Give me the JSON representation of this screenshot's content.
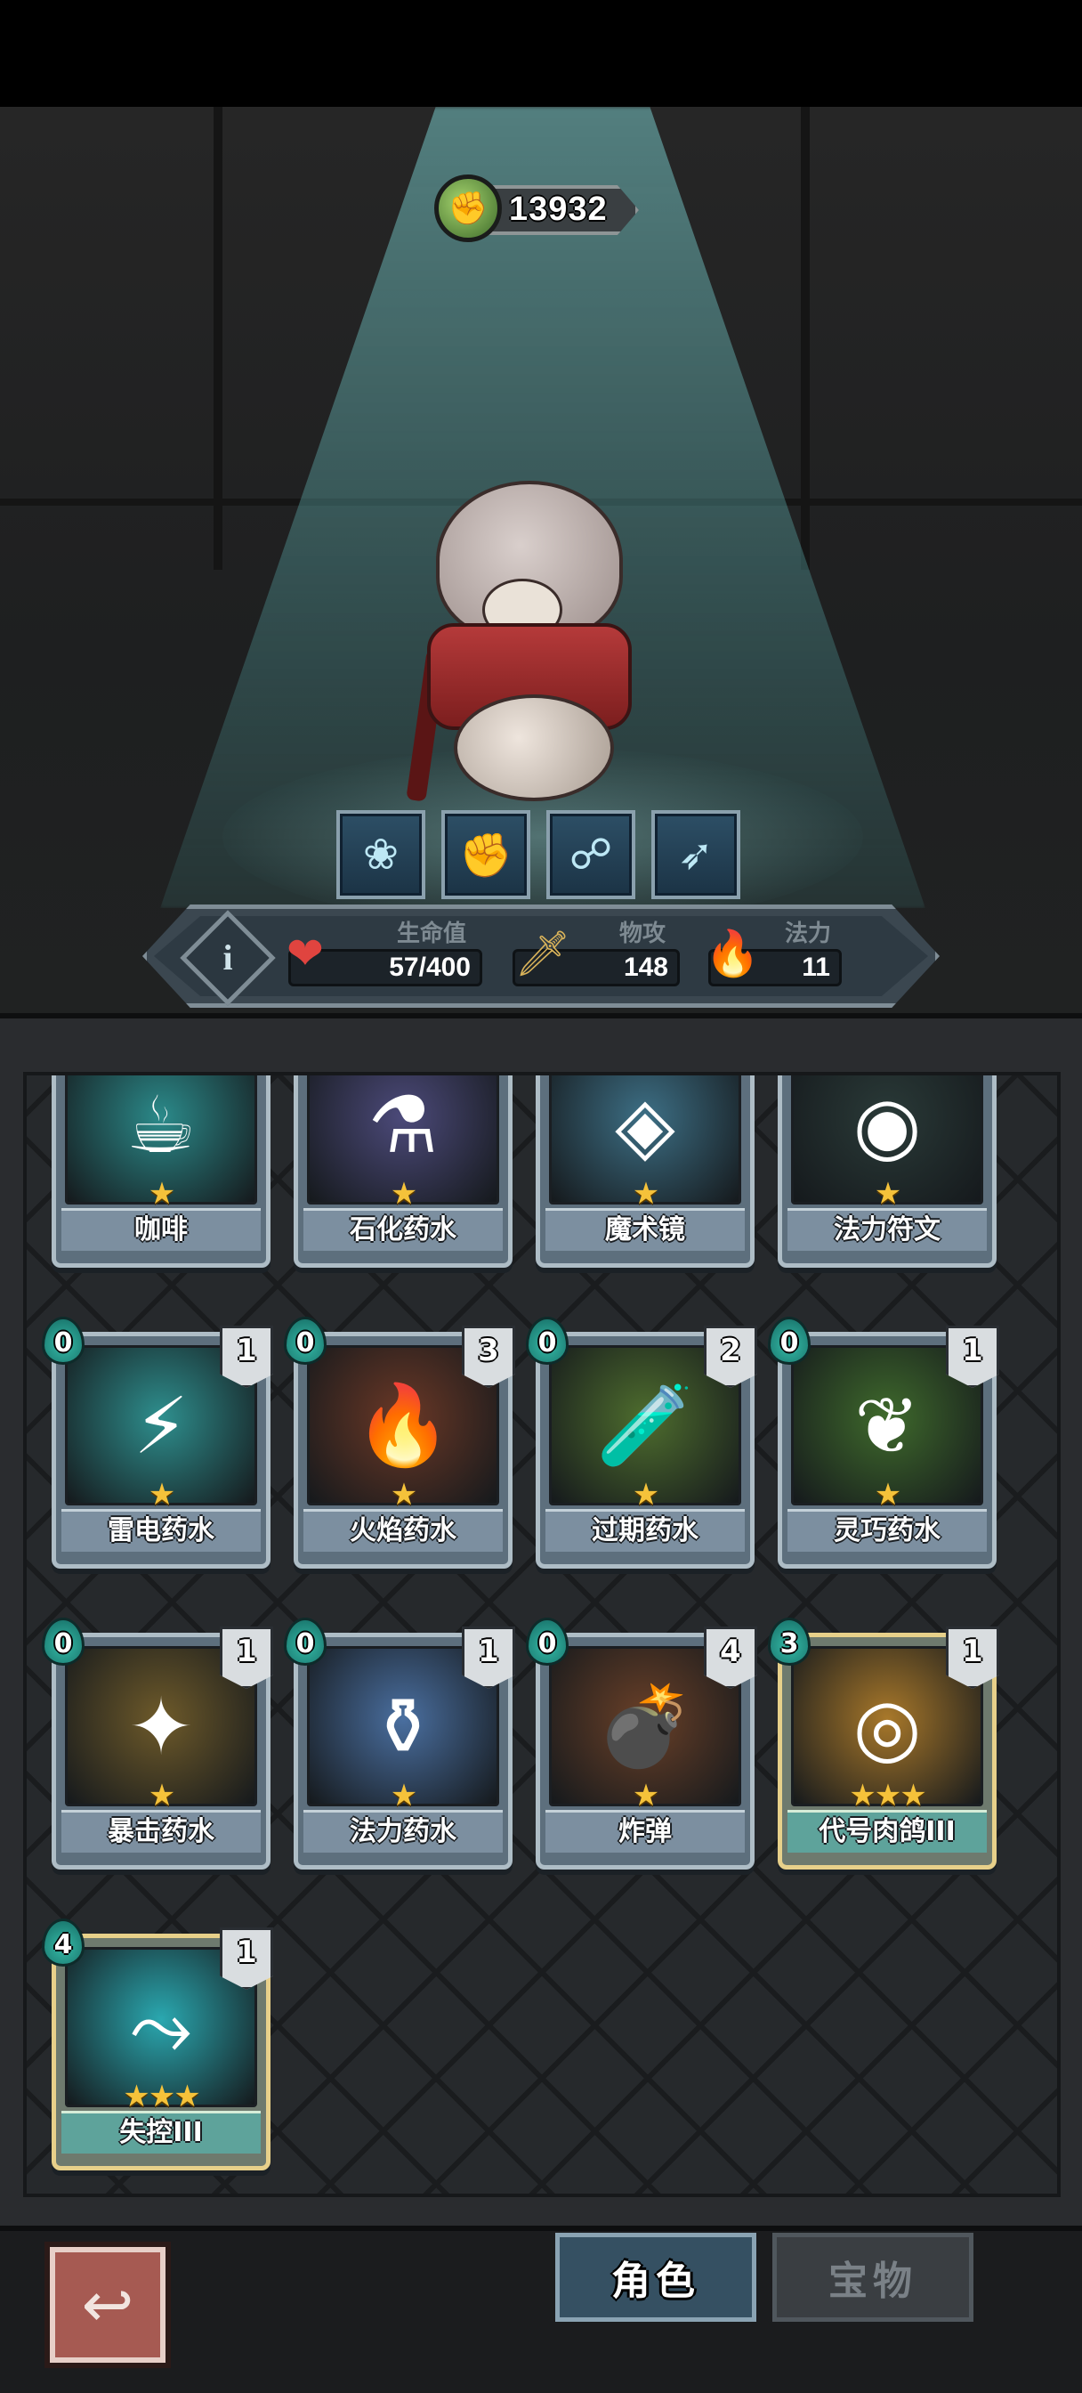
{
  "currency": {
    "icon": "green-gem-icon",
    "value": "13932"
  },
  "stats": {
    "hp": {
      "label": "生命值",
      "value": "57/400",
      "icon": "heart-icon"
    },
    "attack": {
      "label": "物攻",
      "value": "148",
      "icon": "sword-icon"
    },
    "mana": {
      "label": "法力",
      "value": "11",
      "icon": "blue-flame-icon"
    }
  },
  "skills": [
    "frost-rose-skill-icon",
    "flex-arm-skill-icon",
    "twins-skill-icon",
    "dash-skill-icon"
  ],
  "cards": [
    {
      "name": "咖啡",
      "stars": "★",
      "art": "☕",
      "art_color": "#2b8a8a",
      "cost": "",
      "count": ""
    },
    {
      "name": "石化药水",
      "stars": "★",
      "art": "⚗",
      "art_color": "#4c4a7a",
      "cost": "",
      "count": ""
    },
    {
      "name": "魔术镜",
      "stars": "★",
      "art": "◈",
      "art_color": "#3d6f85",
      "cost": "",
      "count": ""
    },
    {
      "name": "法力符文",
      "stars": "★",
      "art": "◉",
      "art_color": "#2a3a38",
      "cost": "",
      "count": ""
    },
    {
      "name": "雷电药水",
      "stars": "★",
      "art": "⚡",
      "art_color": "#2e8f8e",
      "cost": "0",
      "count": "1"
    },
    {
      "name": "火焰药水",
      "stars": "★",
      "art": "🔥",
      "art_color": "#6b3826",
      "cost": "0",
      "count": "3"
    },
    {
      "name": "过期药水",
      "stars": "★",
      "art": "🧪",
      "art_color": "#4e6d2e",
      "cost": "0",
      "count": "2"
    },
    {
      "name": "灵巧药水",
      "stars": "★",
      "art": "❦",
      "art_color": "#3f6a2c",
      "cost": "0",
      "count": "1"
    },
    {
      "name": "暴击药水",
      "stars": "★",
      "art": "✦",
      "art_color": "#6e5a2a",
      "cost": "0",
      "count": "1"
    },
    {
      "name": "法力药水",
      "stars": "★",
      "art": "⚱",
      "art_color": "#4a6fa0",
      "cost": "0",
      "count": "1"
    },
    {
      "name": "炸弹",
      "stars": "★",
      "art": "💣",
      "art_color": "#6a4028",
      "cost": "0",
      "count": "4"
    },
    {
      "name": "代号肉鸽III",
      "stars": "★★★",
      "art": "◎",
      "art_color": "#a8782a",
      "cost": "3",
      "count": "1",
      "gold": true
    },
    {
      "name": "失控III",
      "stars": "★★★",
      "art": "⤳",
      "art_color": "#2aa8b0",
      "cost": "4",
      "count": "1",
      "gold": true
    }
  ],
  "bottom": {
    "back_icon": "back-arrow-icon",
    "tabs": [
      {
        "label": "角色",
        "active": true
      },
      {
        "label": "宝物",
        "active": false
      }
    ]
  }
}
